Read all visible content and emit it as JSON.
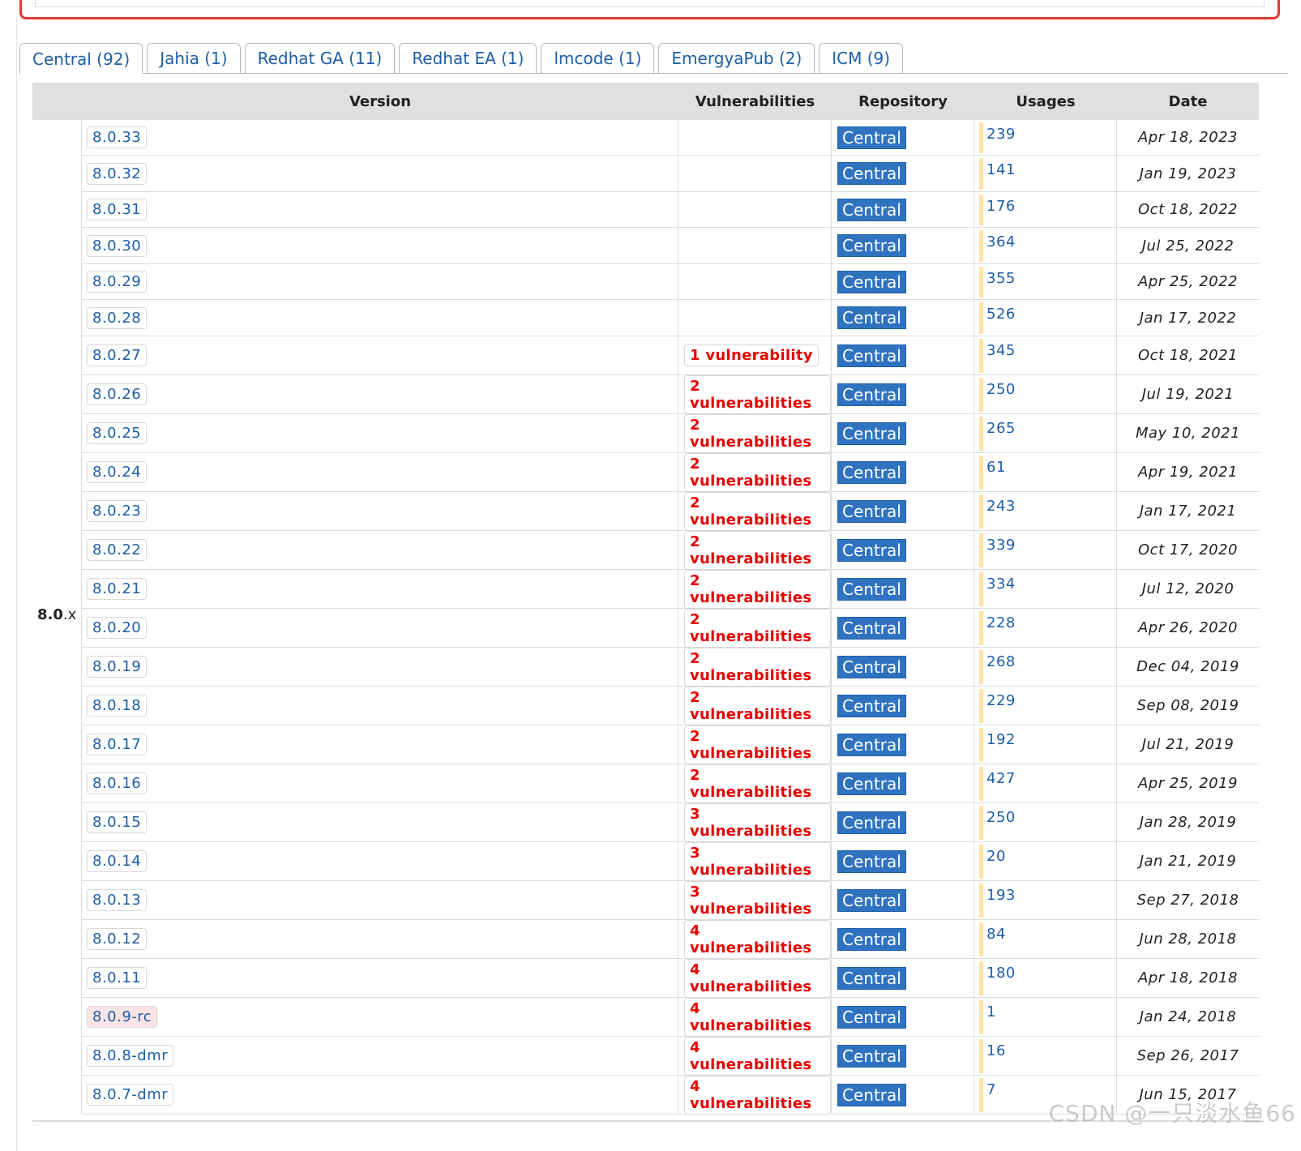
{
  "tabs": [
    {
      "label": "Central (92)",
      "active": true
    },
    {
      "label": "Jahia (1)"
    },
    {
      "label": "Redhat GA (11)"
    },
    {
      "label": "Redhat EA (1)"
    },
    {
      "label": "lmcode (1)"
    },
    {
      "label": "EmergyaPub (2)"
    },
    {
      "label": "ICM (9)"
    }
  ],
  "table": {
    "headers": {
      "version": "Version",
      "vulnerabilities": "Vulnerabilities",
      "repository": "Repository",
      "usages": "Usages",
      "date": "Date"
    },
    "group_label_bold": "8.0",
    "group_label_rest": ".x",
    "rows": [
      {
        "version": "8.0.33",
        "vulns": "",
        "repo": "Central",
        "usages": "239",
        "date": "Apr 18, 2023"
      },
      {
        "version": "8.0.32",
        "vulns": "",
        "repo": "Central",
        "usages": "141",
        "date": "Jan 19, 2023"
      },
      {
        "version": "8.0.31",
        "vulns": "",
        "repo": "Central",
        "usages": "176",
        "date": "Oct 18, 2022"
      },
      {
        "version": "8.0.30",
        "vulns": "",
        "repo": "Central",
        "usages": "364",
        "date": "Jul 25, 2022"
      },
      {
        "version": "8.0.29",
        "vulns": "",
        "repo": "Central",
        "usages": "355",
        "date": "Apr 25, 2022"
      },
      {
        "version": "8.0.28",
        "vulns": "",
        "repo": "Central",
        "usages": "526",
        "date": "Jan 17, 2022"
      },
      {
        "version": "8.0.27",
        "vulns": "1 vulnerability",
        "repo": "Central",
        "usages": "345",
        "date": "Oct 18, 2021"
      },
      {
        "version": "8.0.26",
        "vulns": "2 vulnerabilities",
        "repo": "Central",
        "usages": "250",
        "date": "Jul 19, 2021"
      },
      {
        "version": "8.0.25",
        "vulns": "2 vulnerabilities",
        "repo": "Central",
        "usages": "265",
        "date": "May 10, 2021"
      },
      {
        "version": "8.0.24",
        "vulns": "2 vulnerabilities",
        "repo": "Central",
        "usages": "61",
        "date": "Apr 19, 2021"
      },
      {
        "version": "8.0.23",
        "vulns": "2 vulnerabilities",
        "repo": "Central",
        "usages": "243",
        "date": "Jan 17, 2021"
      },
      {
        "version": "8.0.22",
        "vulns": "2 vulnerabilities",
        "repo": "Central",
        "usages": "339",
        "date": "Oct 17, 2020"
      },
      {
        "version": "8.0.21",
        "vulns": "2 vulnerabilities",
        "repo": "Central",
        "usages": "334",
        "date": "Jul 12, 2020"
      },
      {
        "version": "8.0.20",
        "vulns": "2 vulnerabilities",
        "repo": "Central",
        "usages": "228",
        "date": "Apr 26, 2020"
      },
      {
        "version": "8.0.19",
        "vulns": "2 vulnerabilities",
        "repo": "Central",
        "usages": "268",
        "date": "Dec 04, 2019"
      },
      {
        "version": "8.0.18",
        "vulns": "2 vulnerabilities",
        "repo": "Central",
        "usages": "229",
        "date": "Sep 08, 2019"
      },
      {
        "version": "8.0.17",
        "vulns": "2 vulnerabilities",
        "repo": "Central",
        "usages": "192",
        "date": "Jul 21, 2019"
      },
      {
        "version": "8.0.16",
        "vulns": "2 vulnerabilities",
        "repo": "Central",
        "usages": "427",
        "date": "Apr 25, 2019"
      },
      {
        "version": "8.0.15",
        "vulns": "3 vulnerabilities",
        "repo": "Central",
        "usages": "250",
        "date": "Jan 28, 2019"
      },
      {
        "version": "8.0.14",
        "vulns": "3 vulnerabilities",
        "repo": "Central",
        "usages": "20",
        "date": "Jan 21, 2019"
      },
      {
        "version": "8.0.13",
        "vulns": "3 vulnerabilities",
        "repo": "Central",
        "usages": "193",
        "date": "Sep 27, 2018"
      },
      {
        "version": "8.0.12",
        "vulns": "4 vulnerabilities",
        "repo": "Central",
        "usages": "84",
        "date": "Jun 28, 2018"
      },
      {
        "version": "8.0.11",
        "vulns": "4 vulnerabilities",
        "repo": "Central",
        "usages": "180",
        "date": "Apr 18, 2018"
      },
      {
        "version": "8.0.9-rc",
        "vulns": "4 vulnerabilities",
        "repo": "Central",
        "usages": "1",
        "date": "Jan 24, 2018",
        "rc": true
      },
      {
        "version": "8.0.8-dmr",
        "vulns": "4 vulnerabilities",
        "repo": "Central",
        "usages": "16",
        "date": "Sep 26, 2017"
      },
      {
        "version": "8.0.7-dmr",
        "vulns": "4 vulnerabilities",
        "repo": "Central",
        "usages": "7",
        "date": "Jun 15, 2017"
      }
    ]
  },
  "watermark": "CSDN @一只淡水鱼66",
  "colors": {
    "link": "#1c5ea8",
    "vuln": "#e60000",
    "repo_badge": "#2f73c0",
    "usage_bar": "#ffe3a8",
    "alert_border": "#e53935"
  }
}
